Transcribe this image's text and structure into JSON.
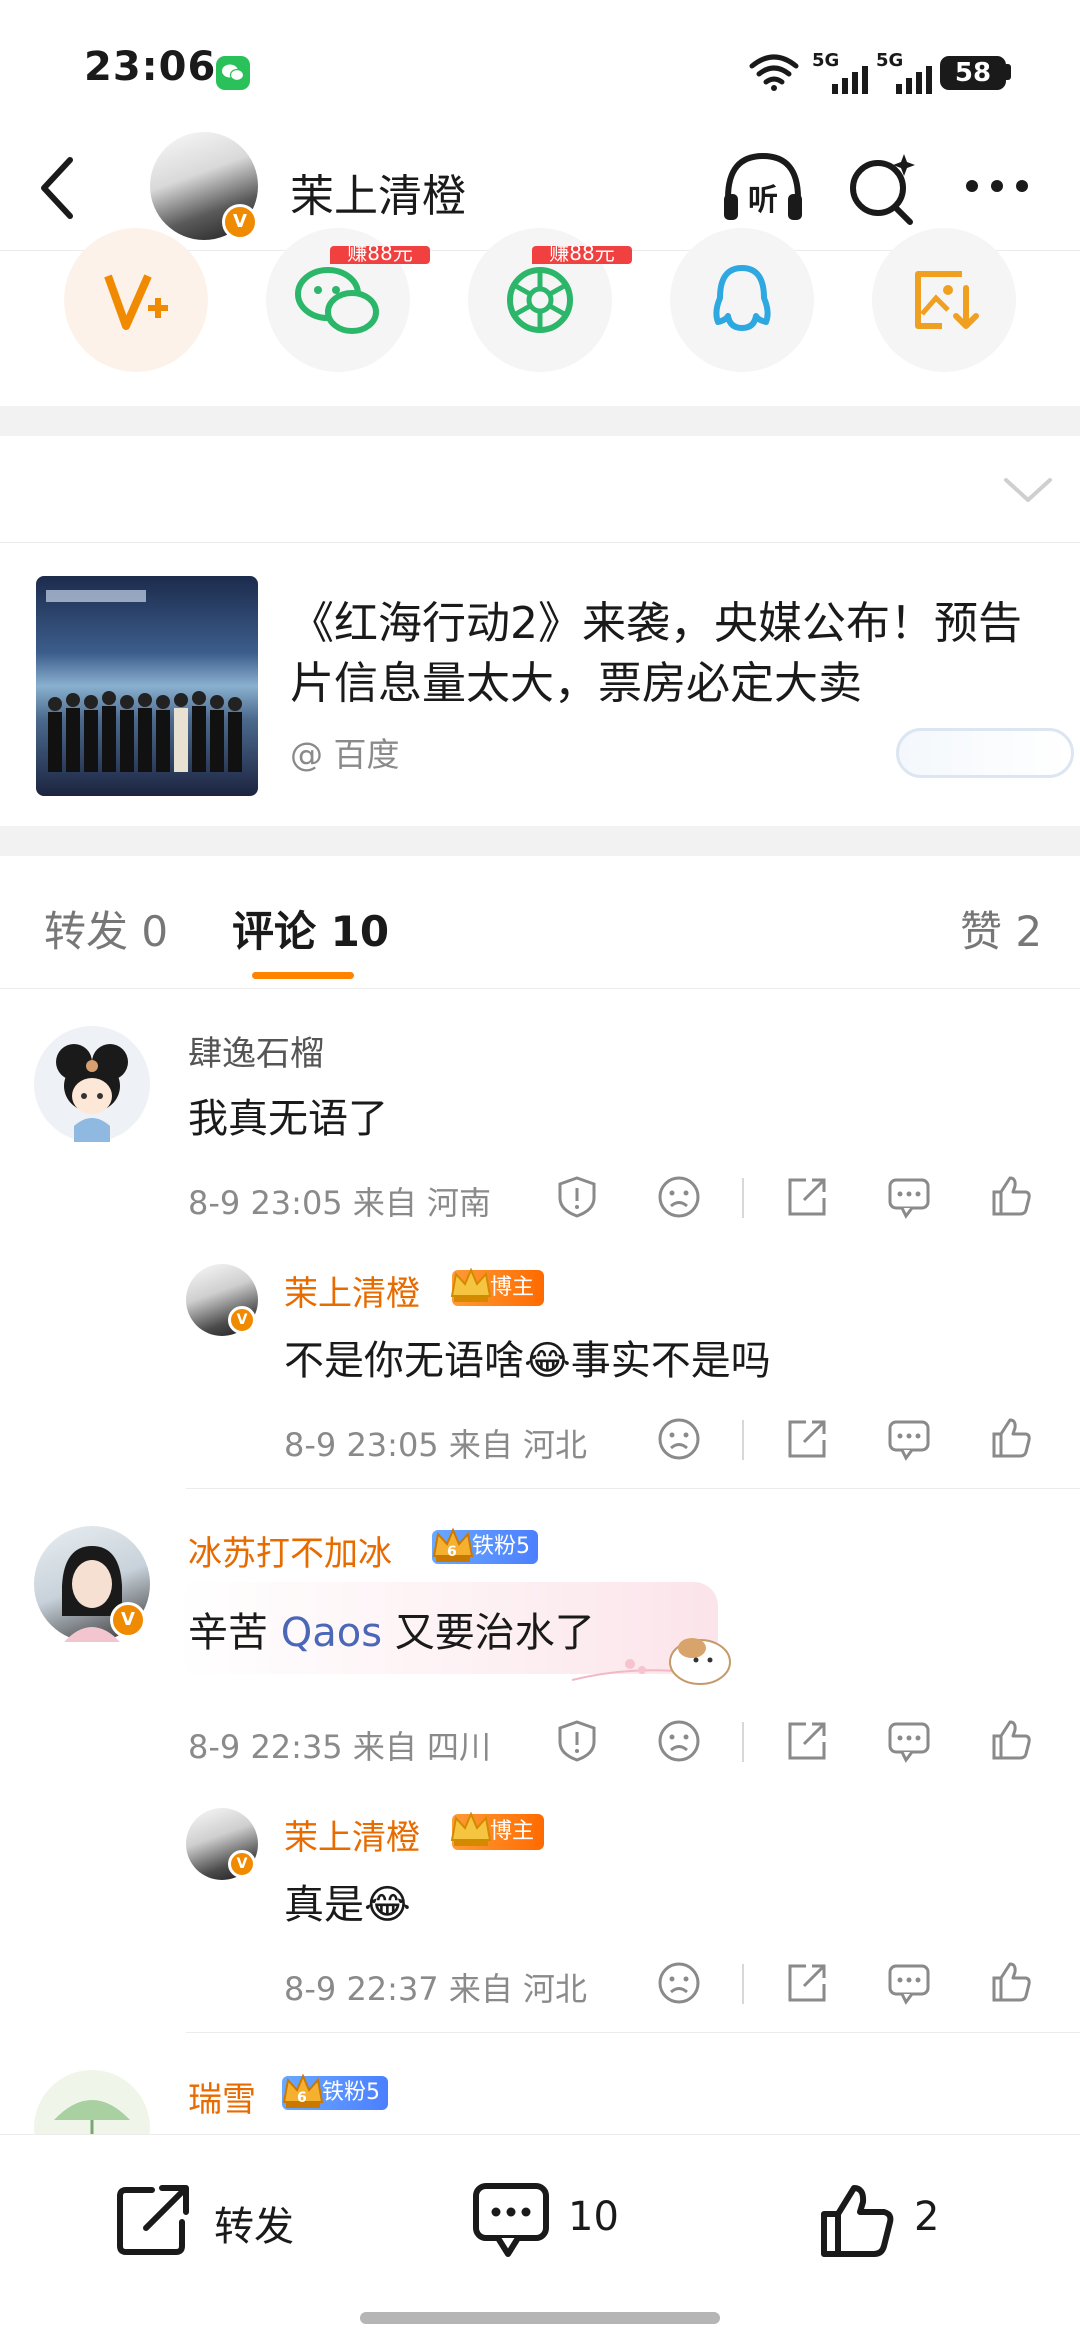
{
  "status_bar": {
    "time": "23:06",
    "signal1": "5G",
    "signal2": "5G",
    "battery": "58"
  },
  "header": {
    "title": "茉上清橙"
  },
  "share": {
    "promo1": "赚88元",
    "promo2": "赚88元"
  },
  "card": {
    "title": "《红海行动2》来袭，央媒公布！预告片信息量太大，票房必定大卖",
    "source": "@ 百度"
  },
  "tabs": {
    "repost": "转发 0",
    "comments": "评论 10",
    "likes": "赞 2"
  },
  "comments": [
    {
      "name": "肆逸石榴",
      "text": "我真无语了",
      "meta": "8-9 23:05  来自 河南",
      "reply": {
        "name": "茉上清橙",
        "badge": "博主",
        "text_a": "不是你无语啥",
        "emoji": "😂",
        "text_b": "事实不是吗",
        "meta": "8-9 23:05  来自 河北"
      }
    },
    {
      "name": "冰苏打不加冰",
      "fan_badge": "铁粉5",
      "fan_level": "6",
      "text_a": "辛苦",
      "mention": "Qaos",
      "text_b": "又要治水了",
      "meta": "8-9 22:35  来自 四川",
      "reply": {
        "name": "茉上清橙",
        "badge": "博主",
        "text_a": "真是",
        "emoji": "😂",
        "meta": "8-9 22:37  来自 河北"
      }
    },
    {
      "name": "瑞雪",
      "fan_badge": "铁粉5",
      "fan_level": "6"
    }
  ],
  "bottom_bar": {
    "repost": "转发",
    "comments": "10",
    "likes": "2"
  },
  "colors": {
    "accent": "#ff8200",
    "vip_orange": "#e86b00",
    "blue_link": "#4a67b8"
  }
}
